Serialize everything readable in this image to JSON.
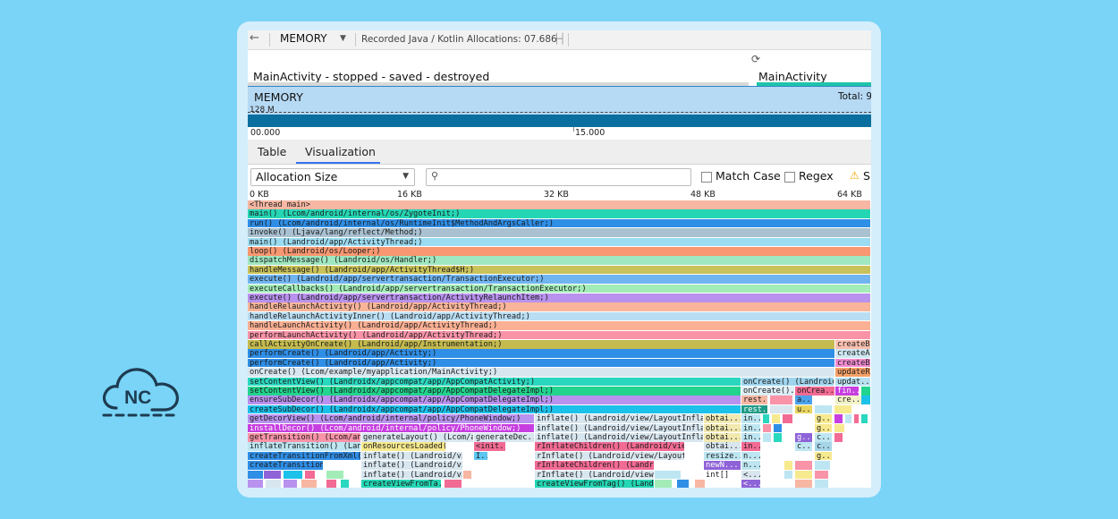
{
  "colors": {
    "background": "#79d4f7",
    "card": "#d4eefb",
    "memory_fill": "#0a6f9e",
    "lifecycle_active": "#1fc4a8",
    "tab_underline": "#3574f0"
  },
  "logo": {
    "text": "NC"
  },
  "toolbar": {
    "back_icon": "arrow-left-icon",
    "profiler_select": "MEMORY",
    "recording_title": "Recorded Java / Kotlin Allocations: 07.686",
    "fit_icon": "fit-width-icon"
  },
  "lifecycle": {
    "activity_left": "MainActivity - stopped - saved - destroyed",
    "activity_right": "MainActivity",
    "rotate_icon": "rotate-device-icon"
  },
  "memory_chart": {
    "label": "MEMORY",
    "total": "Total: 9",
    "marker": "128 M"
  },
  "timeline": {
    "ticks": [
      "00.000",
      "15.000"
    ]
  },
  "tabs": {
    "table": "Table",
    "visualization": "Visualization",
    "active": "Visualization"
  },
  "options": {
    "size_select": "Allocation Size",
    "search_placeholder": "",
    "match_case": "Match Case",
    "regex": "Regex",
    "warn_text": "S"
  },
  "alloc_axis": {
    "ticks": [
      "0 KB",
      "16 KB",
      "32 KB",
      "48 KB",
      "64 KB"
    ]
  },
  "flame": {
    "rows": [
      [
        "<Thread main>",
        "main() (Lcom/android/internal/os/ZygoteInit;)",
        "run() (Lcom/android/internal/os/RuntimeInit$MethodAndArgsCaller;)",
        "invoke() (Ljava/lang/reflect/Method;)",
        "main() (Landroid/app/ActivityThread;)",
        "loop() (Landroid/os/Looper;)",
        "dispatchMessage() (Landroid/os/Handler;)",
        "handleMessage() (Landroid/app/ActivityThread$H;)",
        "execute() (Landroid/app/servertransaction/TransactionExecutor;)",
        "executeCallbacks() (Landroid/app/servertransaction/TransactionExecutor;)",
        "execute() (Landroid/app/servertransaction/ActivityRelaunchItem;)",
        "handleRelaunchActivity() (Landroid/app/ActivityThread;)",
        "handleRelaunchActivityInner() (Landroid/app/ActivityThread;)",
        "handleLaunchActivity() (Landroid/app/ActivityThread;)",
        "performLaunchActivity() (Landroid/app/ActivityThread;)"
      ],
      [
        "callActivityOnCreate() (Landroid/app/Instrumentation;)",
        "createBa",
        "performCreate() (Landroid/app/Activity;)",
        "createAct",
        "performCreate() (Landroid/app/Activity;)",
        "createBa",
        "onCreate() (Lcom/example/myapplication/MainActivity;)",
        "updateRe"
      ],
      [
        "setContentView() (Landroidx/appcompat/app/AppCompatActivity;)",
        "onCreate() (Landroid...",
        "updat...",
        "setContentView() (Landroidx/appcompat/app/AppCompatDelegateImpl;)",
        "onCreate()...",
        "onCrea...",
        "fin...",
        "ensureSubDecor() (Landroidx/appcompat/app/AppCompatDelegateImpl;)",
        "rest...",
        "a...",
        "cre...",
        "createSubDecor() (Landroidx/appcompat/app/AppCompatDelegateImpl;)",
        "rest...",
        "u..."
      ],
      [
        "getDecorView() (Lcom/android/internal/policy/PhoneWindow;)",
        "inflate() (Landroid/view/LayoutInflater;)",
        "obtai...",
        "in...",
        "g...",
        "installDecor() (Lcom/android/internal/policy/PhoneWindow;)",
        "inflate() (Landroid/view/LayoutInflater;)",
        "obtai...",
        "in...",
        "g...",
        "getTransition() (Lcom/andr...",
        "generateLayout() (Lcom/a...",
        "generateDec...",
        "inflate() (Landroid/view/LayoutInflater;)",
        "obtai...",
        "in...",
        "g...",
        "c...",
        "inflateTransition() (Landroi...",
        "onResourcesLoaded() (L...",
        "<init...",
        "rInflateChildren() (Landroid/view/Layo...",
        "obtai...",
        "in...",
        "c...",
        "c..."
      ],
      [
        "createTransitionFromXml() (L...",
        "inflate() (Landroid/view/...",
        "I...",
        "rInflate() (Landroid/view/LayoutInflate...",
        "resize...",
        "n...",
        "g...",
        "createTransitionF...",
        "inflate() (Landroid/view/...",
        "rInflateChildren() (Landroid/v...",
        "newN...",
        "n...",
        "inflate() (Landroid/view/...",
        "rInflate() (Landroid/view/Layo...",
        "int[]",
        "<...",
        "createViewFromTa...",
        "createViewFromTag() (Landr...",
        "<..."
      ]
    ]
  }
}
